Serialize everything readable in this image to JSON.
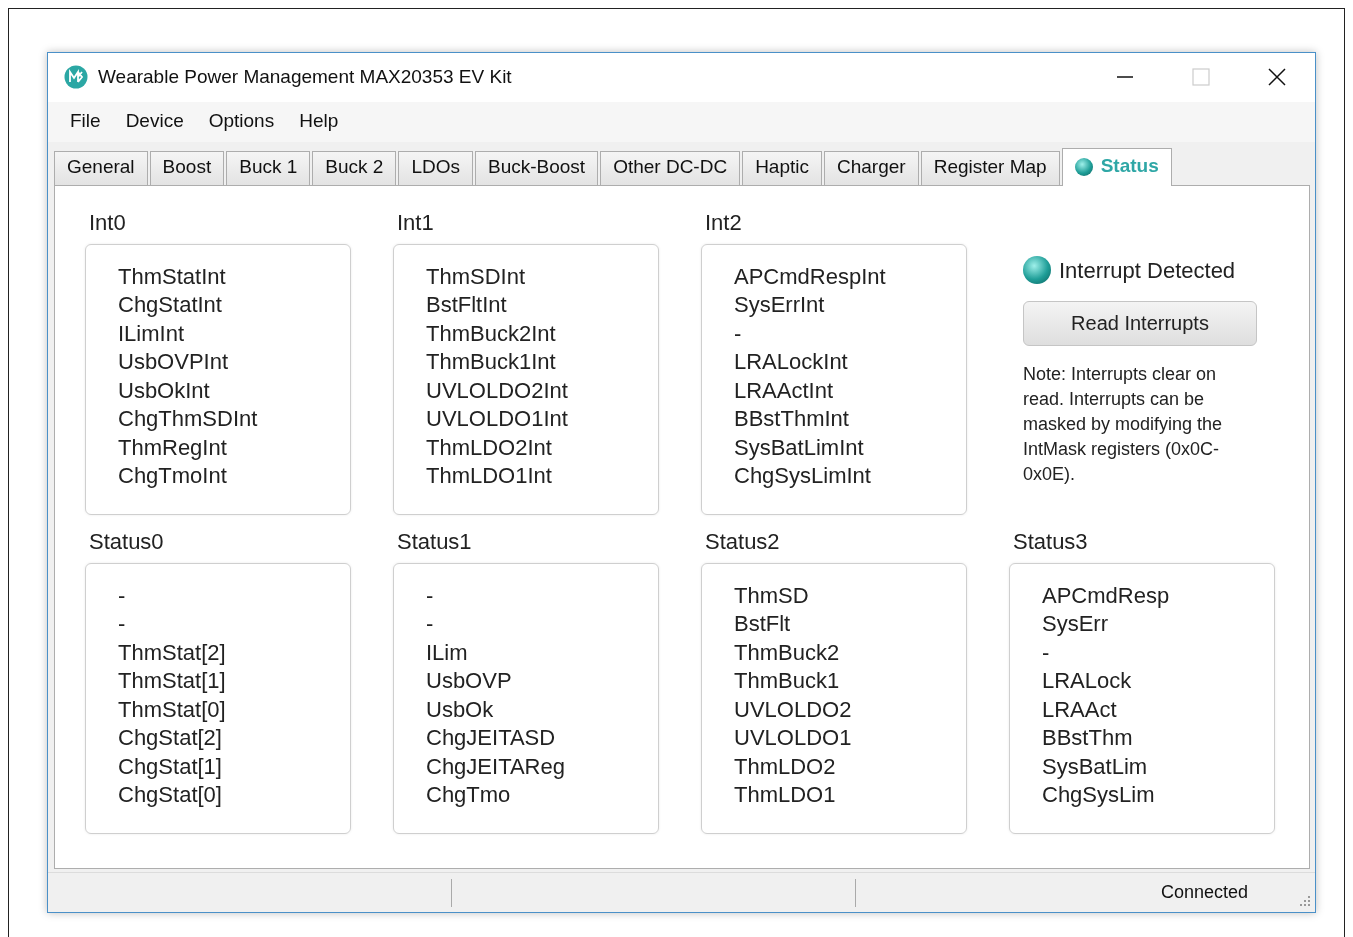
{
  "window": {
    "title": "Wearable Power Management MAX20353 EV Kit"
  },
  "menu": [
    "File",
    "Device",
    "Options",
    "Help"
  ],
  "tabs": [
    {
      "label": "General",
      "selected": false,
      "light": false
    },
    {
      "label": "Boost",
      "selected": false,
      "light": false
    },
    {
      "label": "Buck 1",
      "selected": false,
      "light": false
    },
    {
      "label": "Buck 2",
      "selected": false,
      "light": false
    },
    {
      "label": "LDOs",
      "selected": false,
      "light": false
    },
    {
      "label": "Buck-Boost",
      "selected": false,
      "light": false
    },
    {
      "label": "Other DC-DC",
      "selected": false,
      "light": false
    },
    {
      "label": "Haptic",
      "selected": false,
      "light": false
    },
    {
      "label": "Charger",
      "selected": false,
      "light": false
    },
    {
      "label": "Register Map",
      "selected": false,
      "light": false
    },
    {
      "label": "Status",
      "selected": true,
      "light": true
    }
  ],
  "interrupt_groups": [
    {
      "title": "Int0",
      "items": [
        "ThmStatInt",
        "ChgStatInt",
        "ILimInt",
        "UsbOVPInt",
        "UsbOkInt",
        "ChgThmSDInt",
        "ThmRegInt",
        "ChgTmoInt"
      ]
    },
    {
      "title": "Int1",
      "items": [
        "ThmSDInt",
        "BstFltInt",
        "ThmBuck2Int",
        "ThmBuck1Int",
        "UVLOLDO2Int",
        "UVLOLDO1Int",
        "ThmLDO2Int",
        "ThmLDO1Int"
      ]
    },
    {
      "title": "Int2",
      "items": [
        "APCmdRespInt",
        "SysErrInt",
        "-",
        "LRALockInt",
        "LRAActInt",
        "BBstThmInt",
        "SysBatLimInt",
        "ChgSysLimInt"
      ]
    }
  ],
  "interrupt_panel": {
    "indicator_on": true,
    "indicator_label": "Interrupt Detected",
    "button": "Read Interrupts",
    "note": "Note: Interrupts clear on read. Interrupts can be masked by modifying the IntMask registers (0x0C-0x0E)."
  },
  "status_groups": [
    {
      "title": "Status0",
      "items": [
        "-",
        "-",
        "ThmStat[2]",
        "ThmStat[1]",
        "ThmStat[0]",
        "ChgStat[2]",
        "ChgStat[1]",
        "ChgStat[0]"
      ]
    },
    {
      "title": "Status1",
      "items": [
        "-",
        "-",
        "ILim",
        "UsbOVP",
        "UsbOk",
        "ChgJEITASD",
        "ChgJEITAReg",
        "ChgTmo"
      ]
    },
    {
      "title": "Status2",
      "items": [
        "ThmSD",
        "BstFlt",
        "ThmBuck2",
        "ThmBuck1",
        "UVLOLDO2",
        "UVLOLDO1",
        "ThmLDO2",
        "ThmLDO1"
      ]
    },
    {
      "title": "Status3",
      "items": [
        "APCmdResp",
        "SysErr",
        "-",
        "LRALock",
        "LRAAct",
        "BBstThm",
        "SysBatLim",
        "ChgSysLim"
      ]
    }
  ],
  "status_bar": {
    "text": "Connected"
  }
}
